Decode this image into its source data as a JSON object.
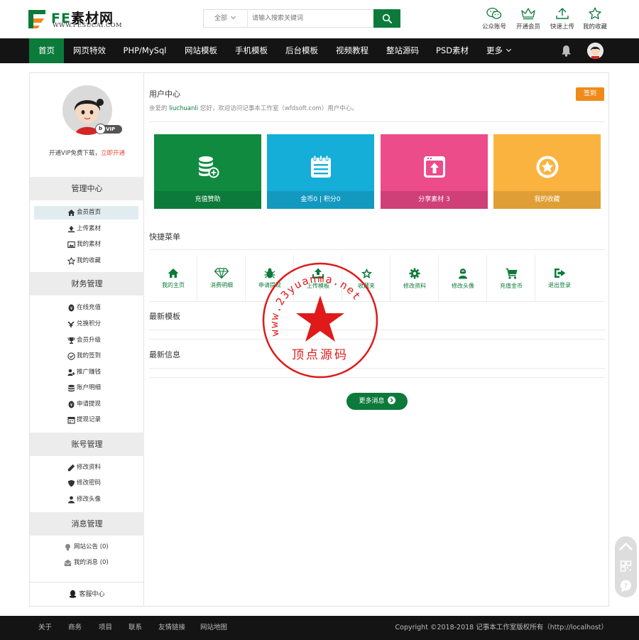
{
  "header": {
    "logo_fe": "FE",
    "logo_cn": "素材网",
    "logo_url": "WWW.FESUCAI.COM",
    "search_category": "全部",
    "search_placeholder": "请输入搜索关键词",
    "top_links": [
      {
        "label": "公众账号",
        "icon": "wechat-icon"
      },
      {
        "label": "开通会员",
        "icon": "crown-icon"
      },
      {
        "label": "快速上传",
        "icon": "upload-icon"
      },
      {
        "label": "我的收藏",
        "icon": "star-icon"
      }
    ]
  },
  "nav": {
    "items": [
      "首页",
      "网页特效",
      "PHP/MySql",
      "网站模板",
      "手机模板",
      "后台模板",
      "视频教程",
      "整站源码",
      "PSD素材",
      "更多"
    ],
    "active_index": 0
  },
  "sidebar": {
    "vip_prefix": "开通VIP免费下载，",
    "vip_link": "立即开通",
    "vip_badge": "VIP",
    "vip_badge_letter": "b",
    "groups": [
      {
        "title": "管理中心",
        "items": [
          {
            "label": "会员首页",
            "icon": "home-icon",
            "active": true
          },
          {
            "label": "上传素材",
            "icon": "upload-icon"
          },
          {
            "label": "我的素材",
            "icon": "image-icon"
          },
          {
            "label": "我的收藏",
            "icon": "star-icon"
          }
        ]
      },
      {
        "title": "财务管理",
        "items": [
          {
            "label": "在线充值",
            "icon": "coin-icon"
          },
          {
            "label": "兑换积分",
            "icon": "exchange-icon"
          },
          {
            "label": "会员升级",
            "icon": "trophy-icon"
          },
          {
            "label": "我的签到",
            "icon": "check-circle-icon"
          },
          {
            "label": "推广赚钱",
            "icon": "user-plus-icon"
          },
          {
            "label": "账户明细",
            "icon": "database-icon"
          },
          {
            "label": "申请提现",
            "icon": "coin-icon"
          },
          {
            "label": "提现记录",
            "icon": "calendar-icon"
          }
        ]
      },
      {
        "title": "账号管理",
        "items": [
          {
            "label": "修改资料",
            "icon": "pencil-icon"
          },
          {
            "label": "修改密码",
            "icon": "shield-icon"
          },
          {
            "label": "修改头像",
            "icon": "user-icon"
          }
        ]
      },
      {
        "title": "消息管理",
        "items": [
          {
            "label": "网站公告 (0)",
            "icon": "bulb-icon"
          },
          {
            "label": "我的消息 (0)",
            "icon": "envelope-icon"
          }
        ]
      }
    ],
    "support": "客服中心"
  },
  "main": {
    "title": "用户中心",
    "welcome_prefix": "亲爱的",
    "username": "liuchuanli",
    "welcome_suffix": "您好，欢迎访问记事本工作室（wfdsoft.com）用户中心。",
    "sign_label": "签到",
    "cards": [
      {
        "label": "充值赞助",
        "icon": "coins-plus-icon",
        "color": "#0f8a3f",
        "bar": "#0c7a3a"
      },
      {
        "label": "金币0 | 积分0",
        "icon": "notepad-icon",
        "color": "#15aed8",
        "bar": "#1399c0"
      },
      {
        "label": "分享素材 3",
        "icon": "share-icon",
        "color": "#ec4c8a",
        "bar": "#cf3f78"
      },
      {
        "label": "我的收藏",
        "icon": "star-circle-icon",
        "color": "#fbb33f",
        "bar": "#e09e36"
      }
    ],
    "quick_title": "快捷菜单",
    "quick_items": [
      {
        "label": "我的主页",
        "icon": "home-icon"
      },
      {
        "label": "消费明细",
        "icon": "diamond-icon"
      },
      {
        "label": "申请提现",
        "icon": "bug-icon"
      },
      {
        "label": "上传模板",
        "icon": "upload-icon"
      },
      {
        "label": "收藏夹",
        "icon": "star-icon"
      },
      {
        "label": "修改资料",
        "icon": "gear-icon"
      },
      {
        "label": "修改头像",
        "icon": "user-icon"
      },
      {
        "label": "充值金币",
        "icon": "cart-icon"
      },
      {
        "label": "退出登录",
        "icon": "logout-icon"
      }
    ],
    "latest_templates": "最新模板",
    "latest_news": "最新信息",
    "more_label": "更多消息"
  },
  "watermark": {
    "url_text": "www.23yuanma.net",
    "cn_text": "顶点源码"
  },
  "footer": {
    "links": [
      "关于",
      "商务",
      "项目",
      "联系",
      "友情链接",
      "网站地图"
    ],
    "copyright": "Copyright ©2018-2018 记事本工作室版权所有（http://localhost）"
  },
  "colors": {
    "brand": "#0c7a3a",
    "nav_bg": "#141414",
    "sign": "#ef8a1a",
    "vip_link": "#e94e3c"
  }
}
